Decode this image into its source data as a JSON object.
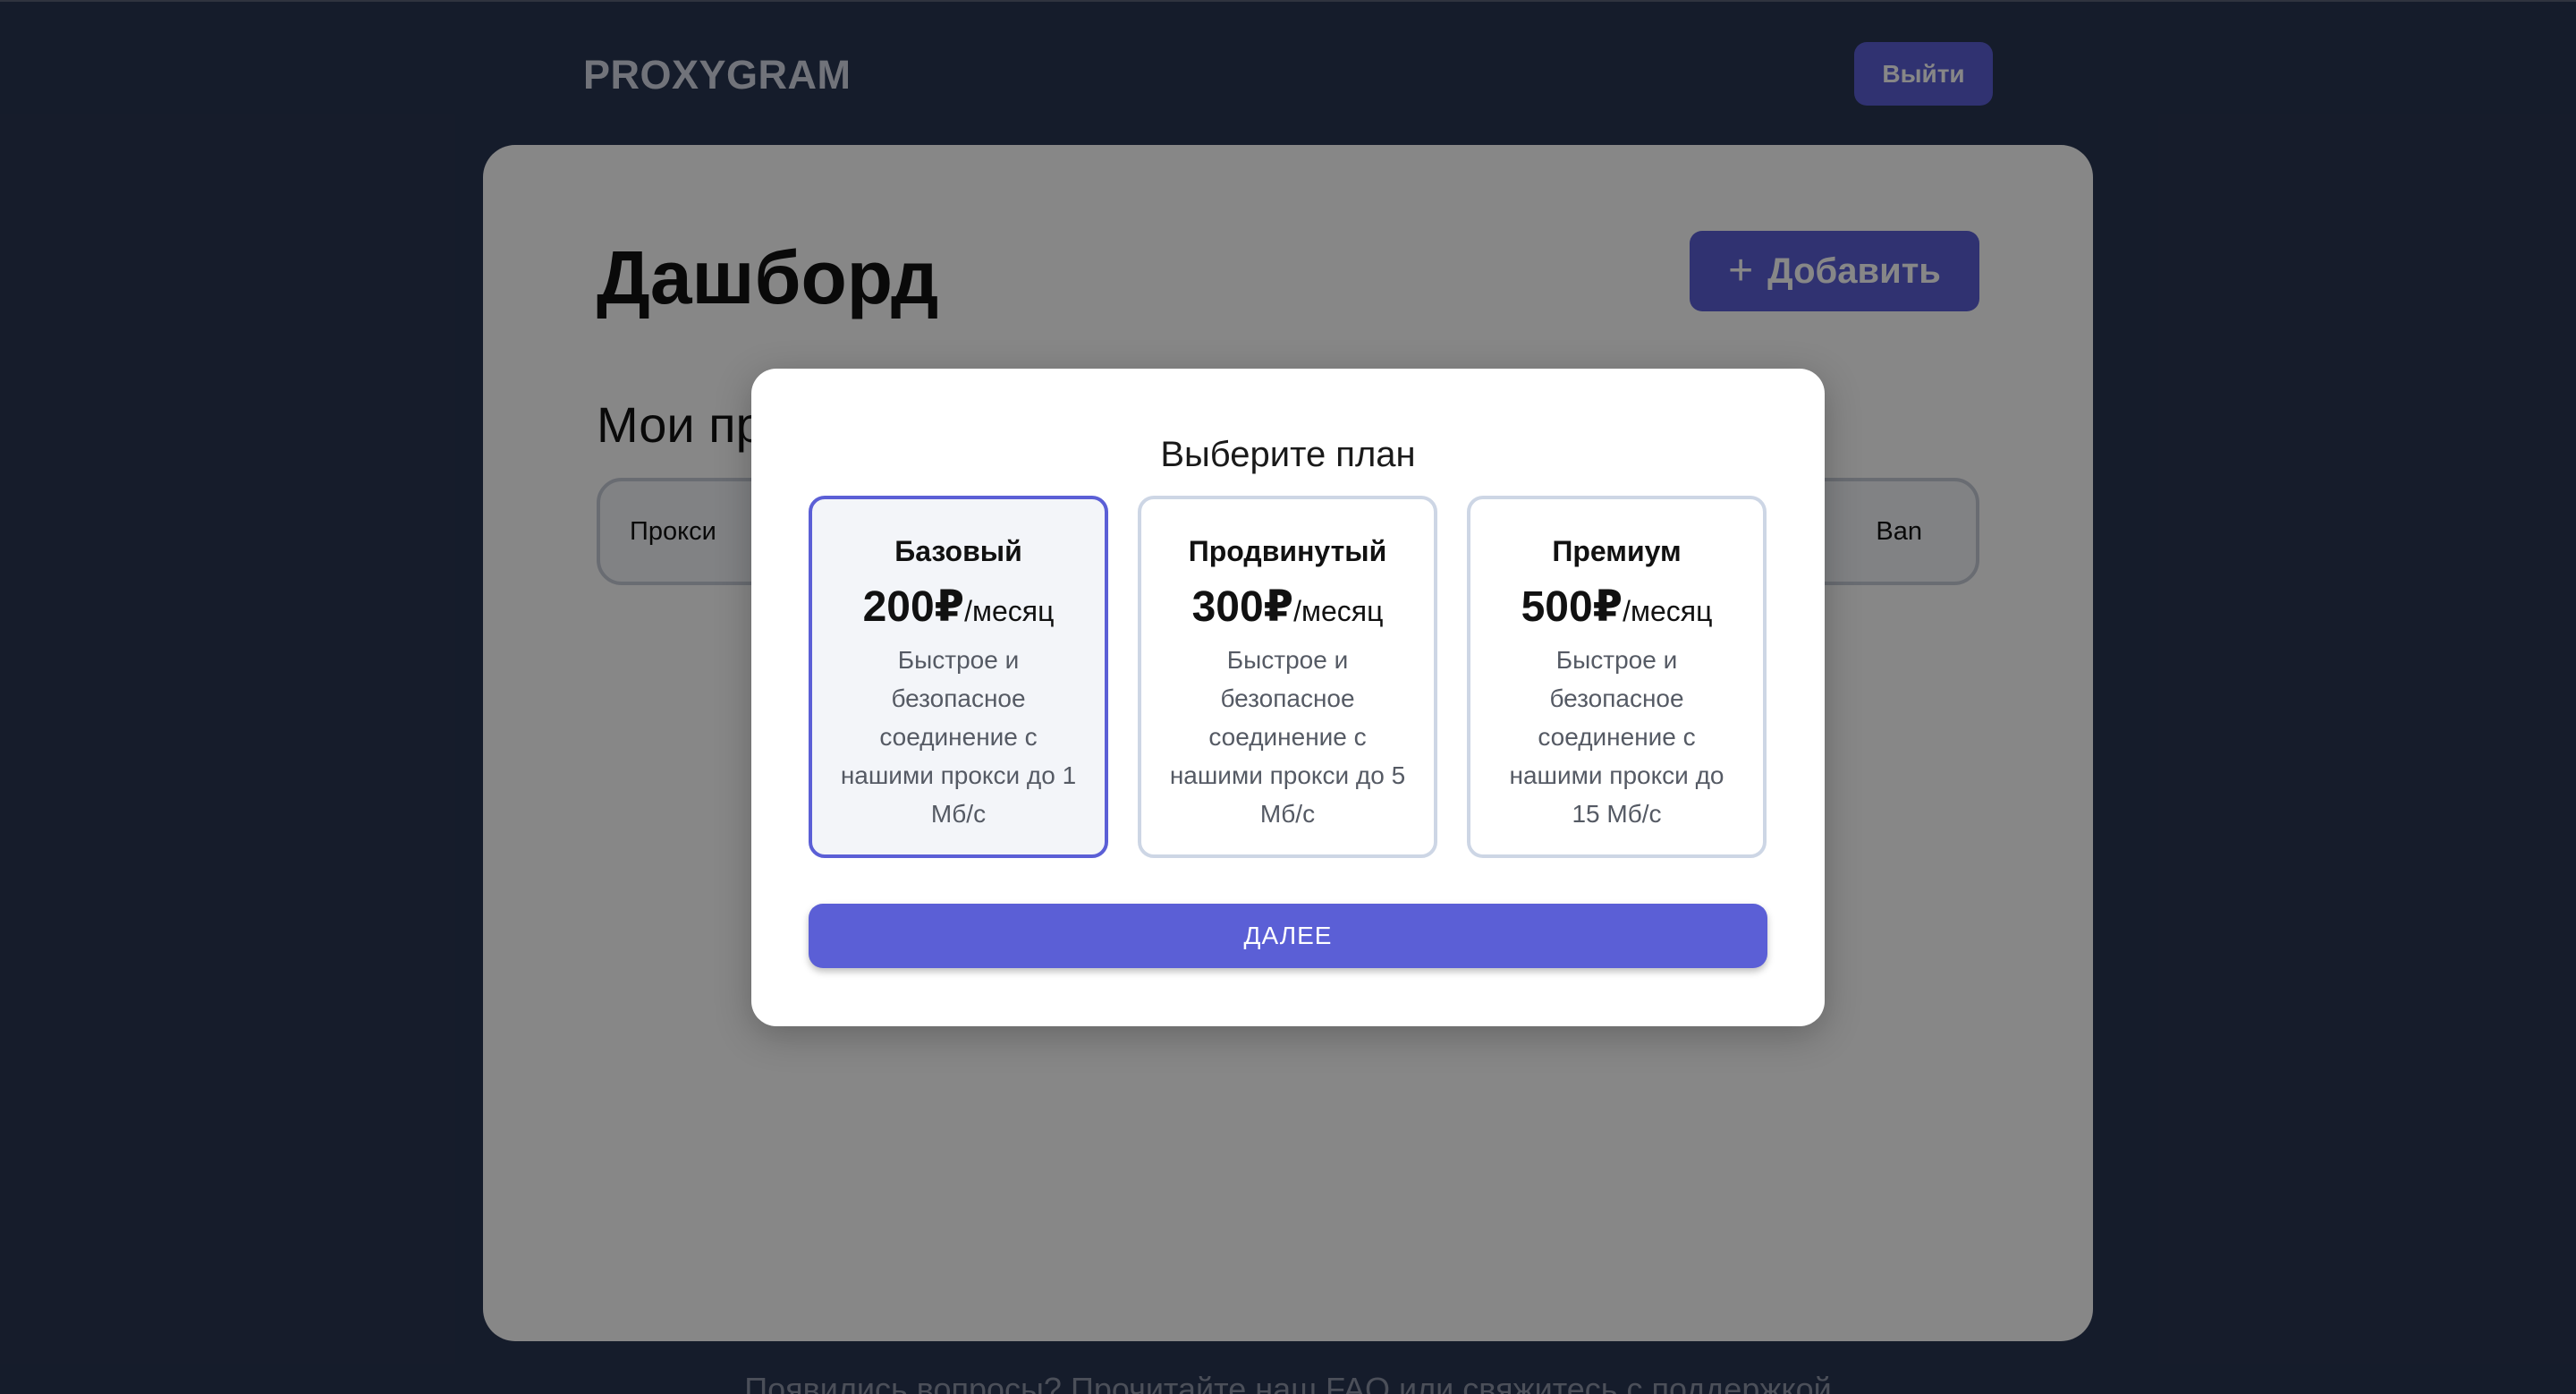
{
  "header": {
    "logo": "PROXYGRAM",
    "logout_label": "Выйти"
  },
  "dashboard": {
    "title": "Дашборд",
    "add_label": "Добавить",
    "section_title": "Мои прокси",
    "table_columns": [
      "Прокси",
      "Ban"
    ]
  },
  "footer": {
    "text": "Появились вопросы? Прочитайте наш FAQ или свяжитесь с поддержкой"
  },
  "modal": {
    "title": "Выберите план",
    "selected_plan": "Базовый",
    "plans": [
      {
        "name": "Базовый",
        "price": "200₽",
        "unit": "/месяц",
        "description": "Быстрое и безопасное соединение с нашими прокси до 1 Мб/с"
      },
      {
        "name": "Продвинутый",
        "price": "300₽",
        "unit": "/месяц",
        "description": "Быстрое и безопасное соединение с нашими прокси до 5 Мб/с"
      },
      {
        "name": "Премиум",
        "price": "500₽",
        "unit": "/месяц",
        "description": "Быстрое и безопасное соединение с нашими прокси до 15 Мб/с"
      }
    ],
    "next_label": "ДАЛЕЕ"
  },
  "colors": {
    "background": "#293552",
    "accent": "#5b5fd6",
    "selected_card_bg": "#f3f5f9",
    "card_border": "#cdd6e5"
  },
  "icons": {
    "add": "plus-icon"
  }
}
